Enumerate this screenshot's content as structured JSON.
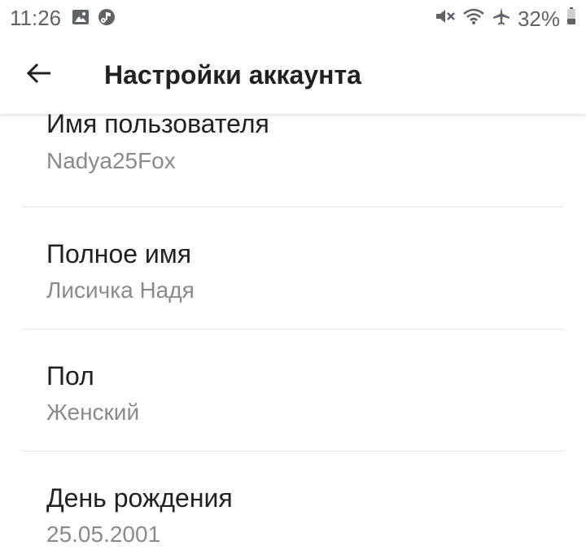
{
  "status_bar": {
    "time": "11:26",
    "battery": "32%",
    "left_icons": [
      "image-icon",
      "music-note-icon"
    ],
    "right_icons": [
      "mute-icon",
      "wifi-icon",
      "airplane-icon",
      "battery-icon"
    ]
  },
  "app_bar": {
    "back_icon": "arrow-back-icon",
    "title": "Настройки аккаунта"
  },
  "fields": [
    {
      "label": "Имя пользователя",
      "value": "Nadya25Fox"
    },
    {
      "label": "Полное имя",
      "value": "Лисичка Надя"
    },
    {
      "label": "Пол",
      "value": "Женский"
    },
    {
      "label": "День рождения",
      "value": "25.05.2001"
    }
  ],
  "colors": {
    "text_primary": "#212121",
    "text_secondary": "#8a8a8a",
    "status_icons": "#5f6368",
    "divider": "#e6e6e6"
  }
}
